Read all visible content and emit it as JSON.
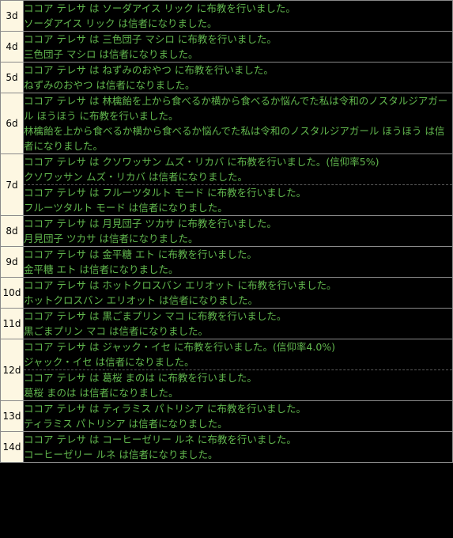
{
  "log": {
    "rows": [
      {
        "day": "3d",
        "lines": [
          [
            "ココア テレサ は ソーダアイス リック に布教を行いました。",
            "ソーダアイス リック は信者になりました。"
          ]
        ]
      },
      {
        "day": "4d",
        "lines": [
          [
            "ココア テレサ は 三色団子 マシロ に布教を行いました。",
            "三色団子 マシロ は信者になりました。"
          ]
        ]
      },
      {
        "day": "5d",
        "lines": [
          [
            "ココア テレサ は ねずみのおやつ に布教を行いました。",
            "ねずみのおやつ は信者になりました。"
          ]
        ]
      },
      {
        "day": "6d",
        "lines": [
          [
            "ココア テレサ は 林檎飴を上から食べるか横から食べるか悩んでた私は令和のノスタルジアガール ほうほう に布教を行いました。",
            "林檎飴を上から食べるか横から食べるか悩んでた私は令和のノスタルジアガール ほうほう は信者になりました。"
          ]
        ]
      },
      {
        "day": "7d",
        "lines": [
          [
            "ココア テレサ は クソワッサン ムズ・リカバ に布教を行いました。(信仰率5%)",
            "クソワッサン ムズ・リカバ は信者になりました。"
          ],
          [
            "ココア テレサ は フルーツタルト モード に布教を行いました。",
            "フルーツタルト モード は信者になりました。"
          ]
        ]
      },
      {
        "day": "8d",
        "lines": [
          [
            "ココア テレサ は 月見団子 ツカサ に布教を行いました。",
            "月見団子 ツカサ は信者になりました。"
          ]
        ]
      },
      {
        "day": "9d",
        "lines": [
          [
            "ココア テレサ は 金平糖 エト に布教を行いました。",
            "金平糖 エト は信者になりました。"
          ]
        ]
      },
      {
        "day": "10d",
        "lines": [
          [
            "ココア テレサ は ホットクロスバン エリオット に布教を行いました。",
            "ホットクロスバン エリオット は信者になりました。"
          ]
        ]
      },
      {
        "day": "11d",
        "lines": [
          [
            "ココア テレサ は 黒ごまプリン マコ に布教を行いました。",
            "黒ごまプリン マコ は信者になりました。"
          ]
        ]
      },
      {
        "day": "12d",
        "lines": [
          [
            "ココア テレサ は ジャック・イセ に布教を行いました。(信仰率4.0%)",
            "ジャック・イセ は信者になりました。"
          ],
          [
            "ココア テレサ は 葛桜 まのは に布教を行いました。",
            "葛桜 まのは は信者になりました。"
          ]
        ]
      },
      {
        "day": "13d",
        "lines": [
          [
            "ココア テレサ は ティラミス パトリシア に布教を行いました。",
            "ティラミス パトリシア は信者になりました。"
          ]
        ]
      },
      {
        "day": "14d",
        "lines": [
          [
            "ココア テレサ は コーヒーゼリー ルネ に布教を行いました。",
            "コーヒーゼリー ルネ は信者になりました。"
          ]
        ]
      }
    ]
  }
}
